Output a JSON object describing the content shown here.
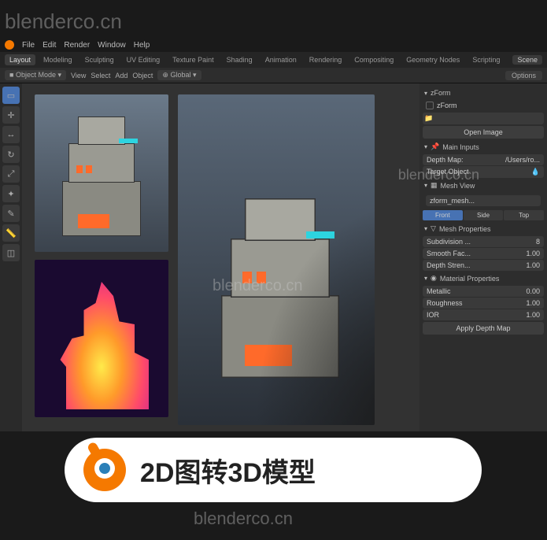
{
  "watermarks": {
    "text": "blenderco.cn"
  },
  "menu": {
    "items": [
      "File",
      "Edit",
      "Render",
      "Window",
      "Help"
    ]
  },
  "tabs": {
    "items": [
      "Layout",
      "Modeling",
      "Sculpting",
      "UV Editing",
      "Texture Paint",
      "Shading",
      "Animation",
      "Rendering",
      "Compositing",
      "Geometry Nodes",
      "Scripting"
    ],
    "active": 0,
    "scene": "Scene"
  },
  "toolbar": {
    "mode": "Object Mode",
    "items": [
      "View",
      "Select",
      "Add",
      "Object"
    ],
    "pivot": "Global",
    "options": "Options"
  },
  "panel": {
    "title": "zForm",
    "check_label": "zForm",
    "open_btn": "Open Image",
    "inputs_hdr": "Main Inputs",
    "depth_map_label": "Depth Map:",
    "depth_map_val": "/Users/ro...",
    "target_label": "Target Object",
    "mesh_hdr": "Mesh View",
    "mesh_name": "zform_mesh...",
    "seg": [
      "Front",
      "Side",
      "Top"
    ],
    "seg_active": 0,
    "props_hdr": "Mesh Properties",
    "subdivision_label": "Subdivision ...",
    "subdivision_val": "8",
    "smooth_label": "Smooth Fac...",
    "smooth_val": "1.00",
    "stren_label": "Depth Stren...",
    "stren_val": "1.00",
    "mat_hdr": "Material Properties",
    "metallic_label": "Metallic",
    "metallic_val": "0.00",
    "rough_label": "Roughness",
    "rough_val": "1.00",
    "ior_label": "IOR",
    "ior_val": "1.00",
    "apply_btn": "Apply Depth Map"
  },
  "banner": {
    "text": "2D图转3D模型"
  }
}
